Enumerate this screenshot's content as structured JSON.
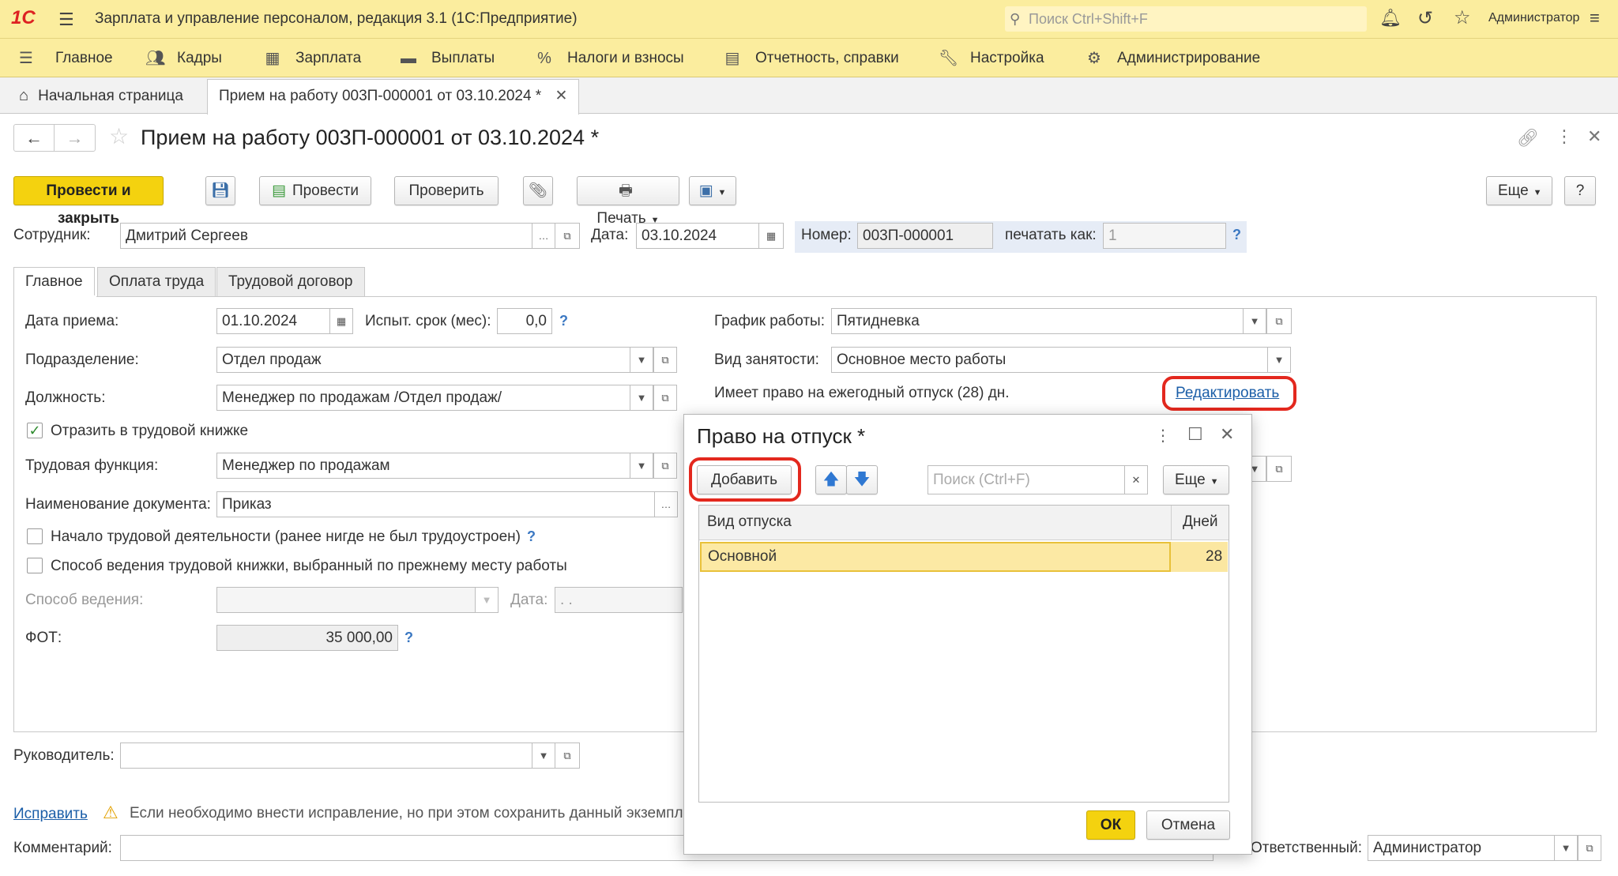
{
  "app": {
    "logo": "1С",
    "title": "Зарплата и управление персоналом, редакция 3.1  (1С:Предприятие)",
    "search_placeholder": "Поиск Ctrl+Shift+F",
    "user": "Администратор"
  },
  "menu": {
    "items": [
      "Главное",
      "Кадры",
      "Зарплата",
      "Выплаты",
      "Налоги и взносы",
      "Отчетность, справки",
      "Настройка",
      "Администрирование"
    ]
  },
  "tabs": {
    "home": "Начальная страница",
    "doc": "Прием на работу 003П-000001 от 03.10.2024 *"
  },
  "doc": {
    "title": "Прием на работу 003П-000001 от 03.10.2024 *",
    "toolbar": {
      "post_close": "Провести и закрыть",
      "post": "Провести",
      "check": "Проверить",
      "print": "Печать",
      "more": "Еще",
      "help": "?"
    },
    "employee_label": "Сотрудник:",
    "employee": "Дмитрий Сергеев",
    "date_label": "Дата:",
    "date": "03.10.2024",
    "number_label": "Номер:",
    "number": "003П-000001",
    "print_as_label": "печатать как:",
    "print_as": "1",
    "inner_tabs": [
      "Главное",
      "Оплата труда",
      "Трудовой договор"
    ],
    "hire_date_label": "Дата приема:",
    "hire_date": "01.10.2024",
    "trial_label": "Испыт. срок (мес):",
    "trial": "0,0",
    "dept_label": "Подразделение:",
    "dept": "Отдел продаж",
    "position_label": "Должность:",
    "position": "Менеджер по продажам /Отдел продаж/",
    "reflect_label": "Отразить в трудовой книжке",
    "function_label": "Трудовая функция:",
    "function": "Менеджер по продажам",
    "docname_label": "Наименование документа:",
    "docname": "Приказ",
    "start_work_label": "Начало трудовой деятельности (ранее нигде не был трудоустроен)",
    "book_method_label": "Способ ведения трудовой книжки, выбранный по прежнему месту работы",
    "method_label": "Способ ведения:",
    "method_date_label": "Дата:",
    "method_date": " .  .",
    "fot_label": "ФОТ:",
    "fot": "35 000,00",
    "schedule_label": "График работы:",
    "schedule": "Пятидневка",
    "employment_label": "Вид занятости:",
    "employment": "Основное место работы",
    "vacation_text": "Имеет право на ежегодный отпуск (28) дн.",
    "edit_link": "Редактировать",
    "manager_label": "Руководитель:",
    "fix_link": "Исправить",
    "fix_text": "Если необходимо внести исправление, но при этом сохранить данный экземпл",
    "comment_label": "Комментарий:",
    "responsible_label": "Ответственный:",
    "responsible": "Администратор"
  },
  "dialog": {
    "title": "Право на отпуск *",
    "add": "Добавить",
    "search_placeholder": "Поиск (Ctrl+F)",
    "more": "Еще",
    "col_type": "Вид отпуска",
    "col_days": "Дней",
    "rows": [
      {
        "type": "Основной",
        "days": "28"
      }
    ],
    "ok": "ОК",
    "cancel": "Отмена"
  },
  "colors": {
    "header_bg": "#fbed9e",
    "accent_yellow": "#f4d20f",
    "highlight_red": "#e3281e",
    "selected_row": "#fbe7a1",
    "link": "#1b5ea8"
  }
}
